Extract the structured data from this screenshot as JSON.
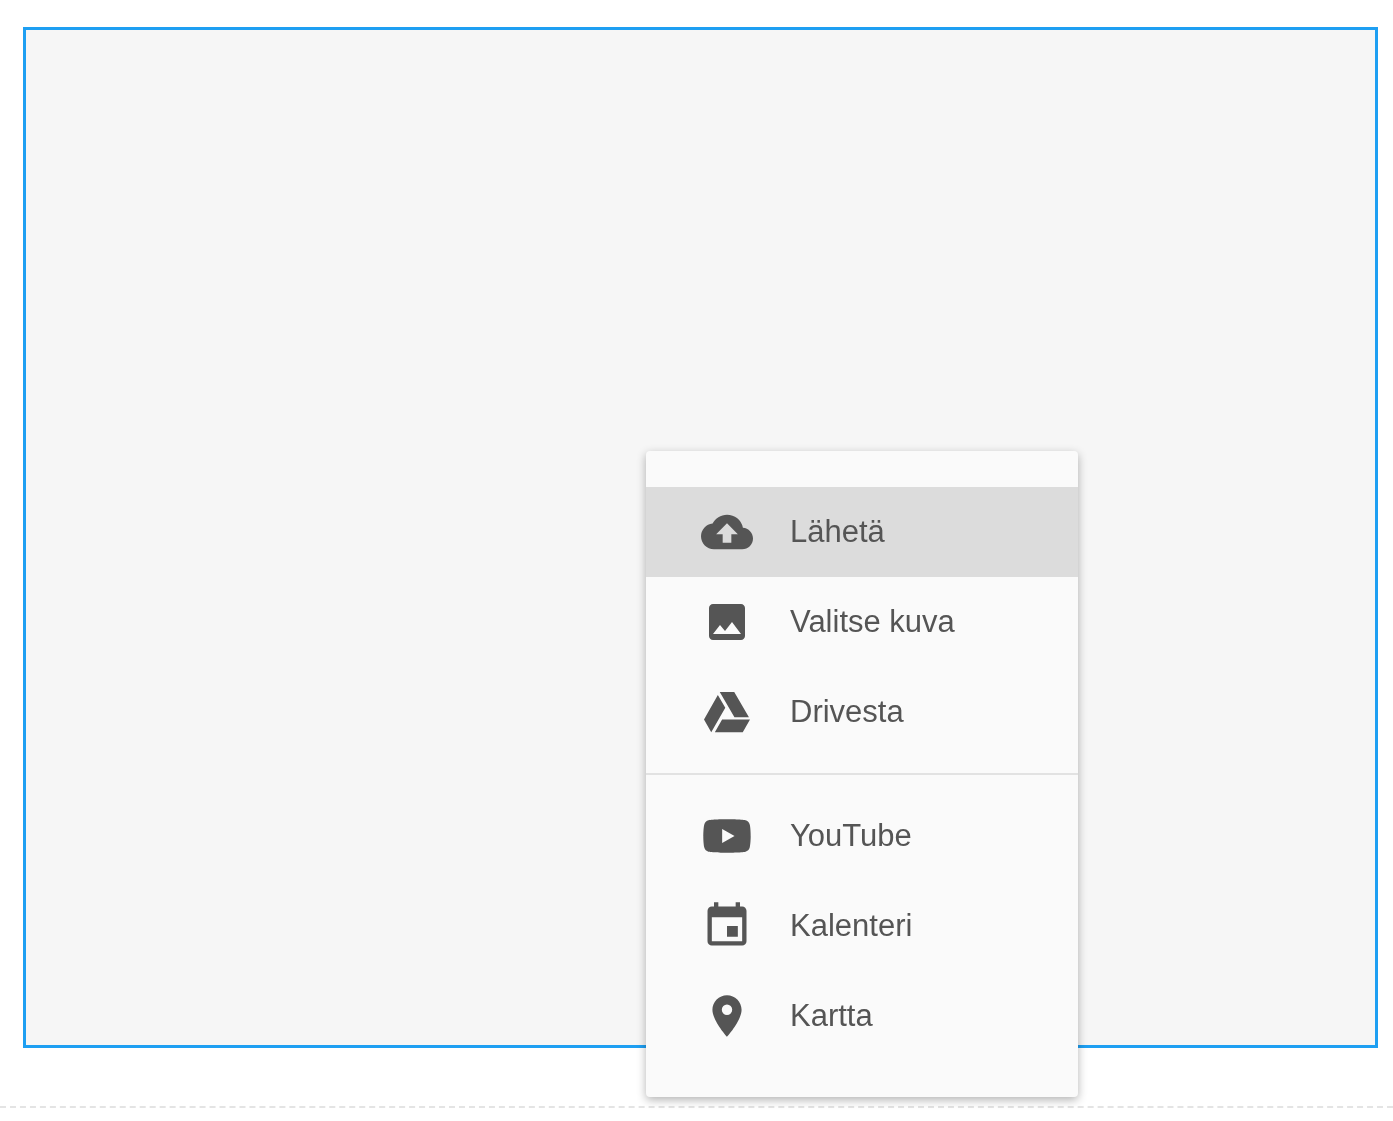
{
  "menu": {
    "groups": [
      {
        "items": [
          {
            "label": "Lähetä",
            "selected": true
          },
          {
            "label": "Valitse kuva",
            "selected": false
          },
          {
            "label": "Drivesta",
            "selected": false
          }
        ]
      },
      {
        "items": [
          {
            "label": "YouTube",
            "selected": false
          },
          {
            "label": "Kalenteri",
            "selected": false
          },
          {
            "label": "Kartta",
            "selected": false
          }
        ]
      }
    ]
  }
}
